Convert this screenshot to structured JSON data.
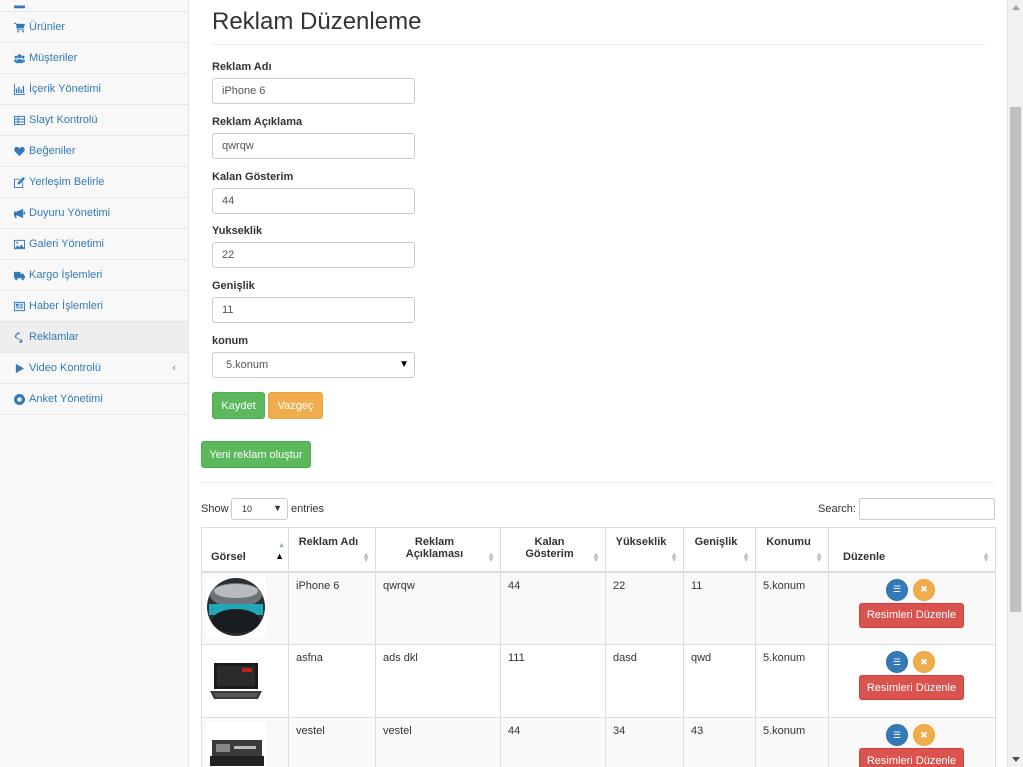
{
  "sidebar": {
    "items": [
      {
        "label": "",
        "icon": "dashboard-icon"
      },
      {
        "label": "Ürünler",
        "icon": "cart-icon"
      },
      {
        "label": "Müşteriler",
        "icon": "users-icon"
      },
      {
        "label": "İçerik Yönetimi",
        "icon": "bar-chart-icon"
      },
      {
        "label": "Slayt Kontrolü",
        "icon": "table-icon"
      },
      {
        "label": "Beğeniler",
        "icon": "heart-icon"
      },
      {
        "label": "Yerleşim Belirle",
        "icon": "edit-icon"
      },
      {
        "label": "Duyuru Yönetimi",
        "icon": "bullhorn-icon"
      },
      {
        "label": "Galeri Yönetimi",
        "icon": "picture-icon"
      },
      {
        "label": "Kargo İşlemleri",
        "icon": "truck-icon"
      },
      {
        "label": "Haber İşlemleri",
        "icon": "newspaper-icon"
      },
      {
        "label": "Reklamlar",
        "icon": "ad-icon"
      },
      {
        "label": "Video Kontrolü",
        "icon": "play-icon"
      },
      {
        "label": "Anket Yönetimi",
        "icon": "lifering-icon"
      }
    ],
    "video_arrow": "‹"
  },
  "page": {
    "title": "Reklam Düzenleme"
  },
  "form": {
    "name_label": "Reklam Adı",
    "name_value": "iPhone 6",
    "desc_label": "Reklam Açıklama",
    "desc_value": "qwrqw",
    "remaining_label": "Kalan Gösterim",
    "remaining_value": "44",
    "height_label": "Yukseklik",
    "height_value": "22",
    "width_label": "Genişlik",
    "width_value": "11",
    "position_label": "konum",
    "position_value": "5.konum",
    "save_label": "Kaydet",
    "cancel_label": "Vazgeç"
  },
  "new_ad_label": "Yeni reklam oluştur",
  "datatable": {
    "show_label": "Show",
    "length_value": "10",
    "entries_label": "entries",
    "search_label": "Search:",
    "columns": [
      "Görsel",
      "Reklam Adı",
      "Reklam Açıklaması",
      "Kalan Gösterim",
      "Yükseklik",
      "Genişlik",
      "Konumu",
      "Düzenle"
    ],
    "rows": [
      {
        "image": "perfume-bottle",
        "name": "iPhone 6",
        "desc": "qwrqw",
        "remaining": "44",
        "height": "22",
        "width": "11",
        "position": "5.konum"
      },
      {
        "image": "laptop",
        "name": "asfna",
        "desc": "ads dkl",
        "remaining": "111",
        "height": "dasd",
        "width": "qwd",
        "position": "5.konum"
      },
      {
        "image": "appliance",
        "name": "vestel",
        "desc": "vestel",
        "remaining": "44",
        "height": "34",
        "width": "43",
        "position": "5.konum"
      }
    ],
    "edit_images_label": "Resimleri Düzenle"
  },
  "colors": {
    "link": "#337ab7",
    "success": "#5cb85c",
    "warning": "#f0ad4e",
    "danger": "#d9534f",
    "primary": "#337ab7"
  }
}
